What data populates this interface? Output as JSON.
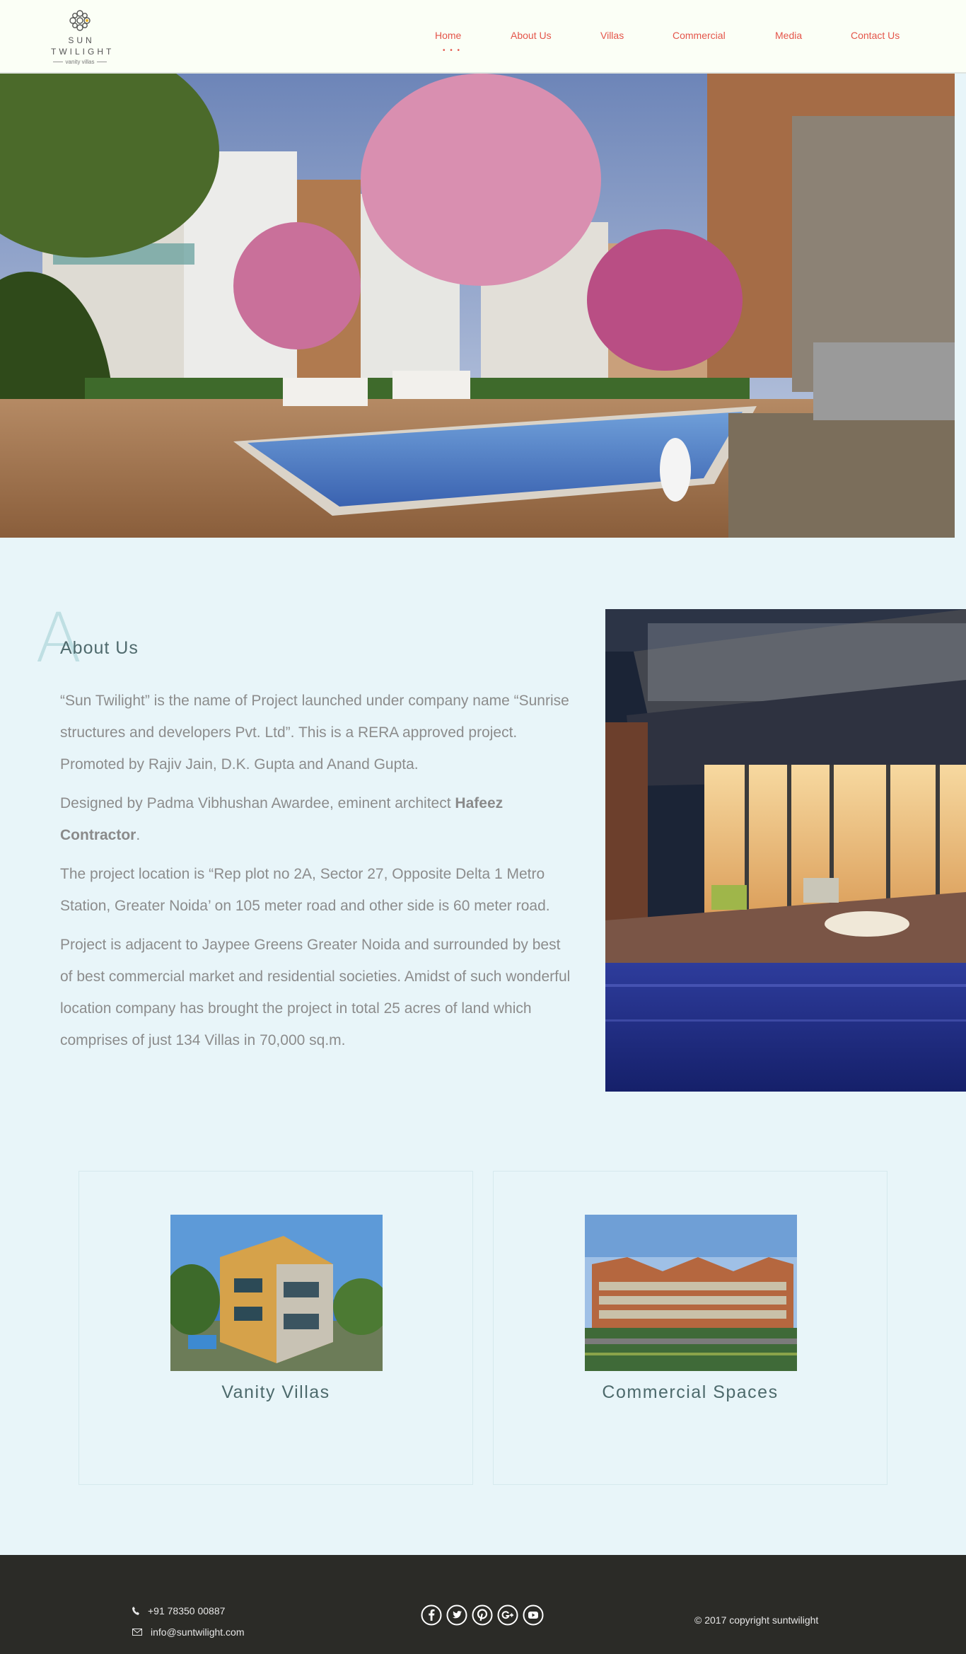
{
  "header": {
    "logo": {
      "line1": "SUN",
      "line2": "TWILIGHT",
      "tagline": "vanity villas"
    },
    "nav": [
      {
        "label": "Home"
      },
      {
        "label": "About Us"
      },
      {
        "label": "Villas"
      },
      {
        "label": "Commercial"
      },
      {
        "label": "Media"
      },
      {
        "label": "Contact Us"
      }
    ],
    "active_indicator": "• • •"
  },
  "about": {
    "decor_letter": "A",
    "heading": "About Us",
    "p1": "“Sun Twilight” is the name of Project launched under company name “Sunrise structures and developers Pvt. Ltd”. This is a RERA approved project. Promoted by Rajiv Jain, D.K. Gupta and Anand Gupta.",
    "p2_prefix": "Designed by Padma Vibhushan Awardee, eminent architect ",
    "p2_bold": "Hafeez Contractor",
    "p2_suffix": ".",
    "p3": "The project location is “Rep plot no 2A, Sector 27, Opposite Delta 1 Metro Station, Greater Noida’ on 105 meter road and other side is 60 meter road.",
    "p4": "Project is adjacent to Jaypee Greens Greater Noida and surrounded by best of best commercial market and residential societies. Amidst of such wonderful location company has brought the project in total 25 acres of land which comprises of just 134 Villas in 70,000 sq.m."
  },
  "cards": [
    {
      "title": "Vanity Villas"
    },
    {
      "title": "Commercial Spaces"
    }
  ],
  "footer": {
    "phone": "+91 78350 00887",
    "email": "info@suntwilight.com",
    "social_icons": [
      "facebook-icon",
      "twitter-icon",
      "pinterest-icon",
      "google-plus-icon",
      "youtube-icon"
    ],
    "copyright": "© 2017 copyright suntwilight"
  },
  "colors": {
    "nav_text": "#e4554a",
    "page_bg": "#e8f5f9",
    "footer_bg": "#2b2b27",
    "heading": "#4f6a6d"
  }
}
